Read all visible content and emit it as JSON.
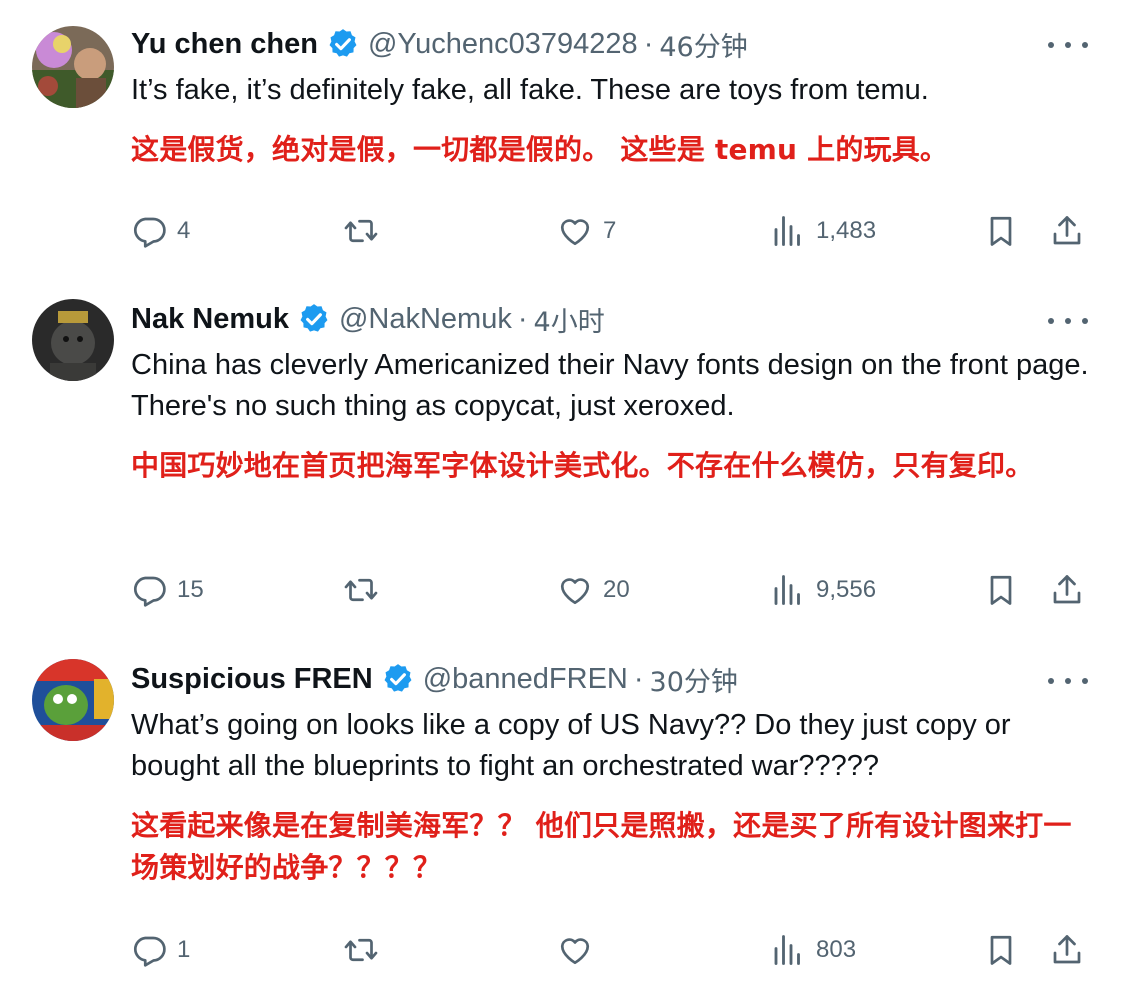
{
  "tweets": [
    {
      "name": "Yu chen chen",
      "handle": "@Yuchenc03794228",
      "separator": "·",
      "time": "46分钟",
      "text_en": "It’s fake,  it’s definitely fake, all fake.  These are toys from temu.",
      "text_zh": "这是假货，绝对是假，一切都是假的。 这些是 temu 上的玩具。",
      "replies": "4",
      "reposts": "",
      "likes": "7",
      "views": "1,483"
    },
    {
      "name": "Nak Nemuk",
      "handle": "@NakNemuk",
      "separator": "·",
      "time": "4小时",
      "text_en": "China has cleverly Americanized their Navy fonts design on the front page. There's no such thing as copycat, just xeroxed.",
      "text_zh": "中国巧妙地在首页把海军字体设计美式化。不存在什么模仿，只有复印。",
      "replies": "15",
      "reposts": "",
      "likes": "20",
      "views": "9,556"
    },
    {
      "name": "Suspicious FREN",
      "handle": "@bannedFREN",
      "separator": "·",
      "time": "30分钟",
      "text_en": "What’s going on looks like a copy of US Navy?? Do they just copy or bought all the blueprints to fight an orchestrated war?????",
      "text_zh": "这看起来像是在复制美海军？？ 他们只是照搬，还是买了所有设计图来打一场策划好的战争？？？？",
      "replies": "1",
      "reposts": "",
      "likes": "",
      "views": "803"
    }
  ],
  "icons": {
    "reply": "reply-icon",
    "repost": "repost-icon",
    "like": "heart-icon",
    "views": "views-icon",
    "bookmark": "bookmark-icon",
    "share": "share-icon",
    "more": "more-icon",
    "verified": "verified-badge-icon"
  },
  "colors": {
    "translation": "#e0201a",
    "secondary_text": "#536471",
    "verified": "#1d9bf0"
  }
}
